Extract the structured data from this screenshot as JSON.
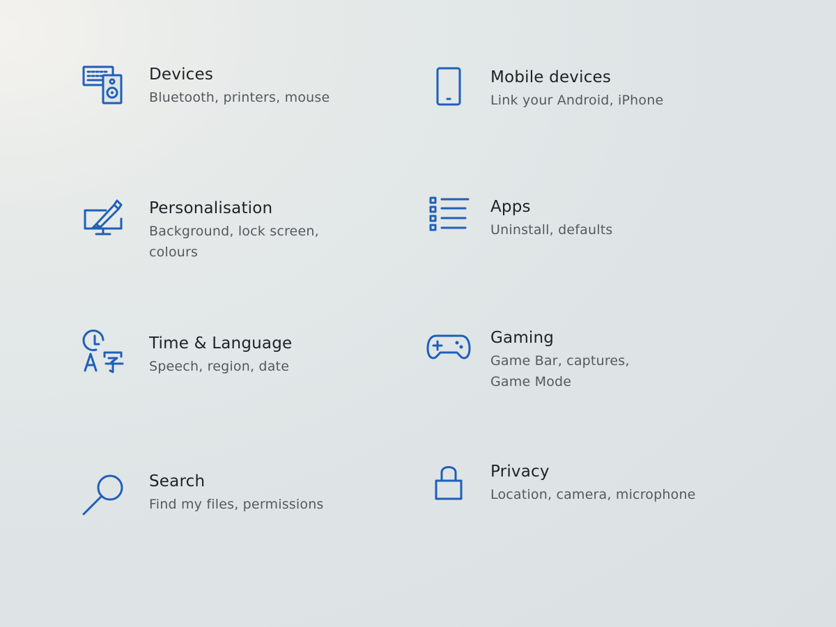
{
  "settings": {
    "tiles": [
      {
        "key": "devices",
        "title": "Devices",
        "desc": "Bluetooth, printers, mouse",
        "icon": "devices-icon"
      },
      {
        "key": "mobile",
        "title": "Mobile devices",
        "desc": "Link your Android, iPhone",
        "icon": "phone-icon"
      },
      {
        "key": "personalisation",
        "title": "Personalisation",
        "desc": "Background, lock screen, colours",
        "icon": "paintbrush-monitor-icon"
      },
      {
        "key": "apps",
        "title": "Apps",
        "desc": "Uninstall, defaults",
        "icon": "apps-list-icon"
      },
      {
        "key": "time",
        "title": "Time & Language",
        "desc": "Speech, region, date",
        "icon": "time-language-icon"
      },
      {
        "key": "gaming",
        "title": "Gaming",
        "desc": "Game Bar, captures, Game Mode",
        "icon": "gamepad-icon"
      },
      {
        "key": "search",
        "title": "Search",
        "desc": "Find my files, permissions",
        "icon": "search-icon"
      },
      {
        "key": "privacy",
        "title": "Privacy",
        "desc": "Location, camera, microphone",
        "icon": "lock-icon"
      }
    ]
  },
  "colors": {
    "accent": "#1f5fb8",
    "title_text": "#1e2226",
    "desc_text": "#55595d",
    "background": "#dfe5e6"
  }
}
